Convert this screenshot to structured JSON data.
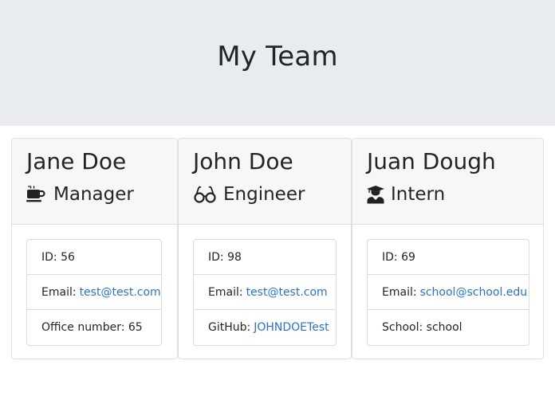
{
  "header": {
    "title": "My Team"
  },
  "cards": [
    {
      "name": "Jane Doe",
      "role": "Manager",
      "role_icon": "coffee-icon",
      "id_label": "ID: 56",
      "email_label": "Email:",
      "email": "test@test.com",
      "extra_label": "Office number: 65"
    },
    {
      "name": "John Doe",
      "role": "Engineer",
      "role_icon": "glasses-icon",
      "id_label": "ID: 98",
      "email_label": "Email:",
      "email": "test@test.com",
      "extra_label": "GitHub:",
      "extra_link": "JOHNDOETest"
    },
    {
      "name": "Juan Dough",
      "role": "Intern",
      "role_icon": "graduate-icon",
      "id_label": "ID: 69",
      "email_label": "Email:",
      "email": "school@school.edu",
      "extra_label": "School: school"
    }
  ],
  "colors": {
    "jumbotron_bg": "#e9ecef",
    "header_bg": "#f7f7f7",
    "link": "#2a73c9"
  }
}
